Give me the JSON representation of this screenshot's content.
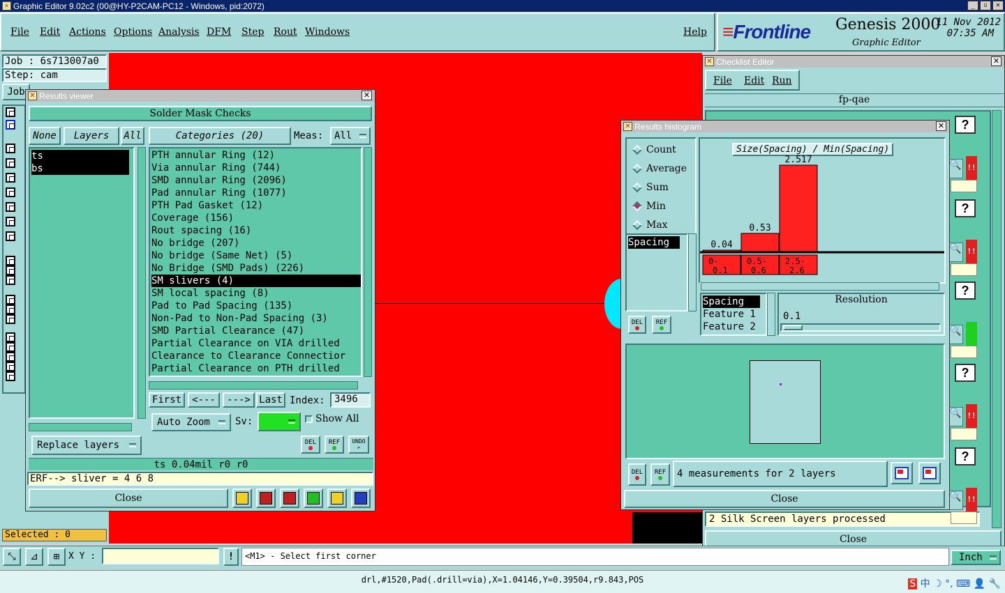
{
  "window": {
    "title": "Graphic Editor 9.02c2 (00@HY-P2CAM-PC12 - Windows, pid:2072)"
  },
  "menu": [
    "File",
    "Edit",
    "Actions",
    "Options",
    "Analysis",
    "DFM",
    "Step",
    "Rout",
    "Windows"
  ],
  "menu_help": "Help",
  "brand": {
    "name": "Frontline",
    "product": "Genesis 2000",
    "subtitle": "Graphic Editor",
    "date": "11 Nov 2012",
    "time": "07:35 AM"
  },
  "left_panel": {
    "job": "Job  : 6s713007a0",
    "step": "Step: cam",
    "job_btn": "Job",
    "selected": "Selected : 0"
  },
  "results_viewer": {
    "title": "Results viewer",
    "heading": "Solder Mask Checks",
    "none_btn": "None",
    "layers_btn": "Layers",
    "all_btn": "All",
    "layers": [
      "ts",
      "bs"
    ],
    "categories_btn": "Categories (20)",
    "meas_label": "Meas:",
    "meas_value": "All",
    "categories": [
      "PTH annular Ring (12)",
      "Via annular Ring (744)",
      "SMD annular Ring (2096)",
      "Pad annular Ring (1077)",
      "PTH Pad Gasket (12)",
      "Coverage (156)",
      "Rout spacing (16)",
      "No bridge (207)",
      "No bridge (Same Net) (5)",
      "No Bridge (SMD Pads) (226)",
      "SM slivers (4)",
      "SM local spacing (8)",
      "Pad to Pad Spacing (135)",
      "Non-Pad to Non-Pad Spacing (3)",
      "SMD Partial Clearance (47)",
      "Partial Clearance on VIA drilled",
      "Clearance to Clearance Connectior",
      "Partial Clearance on PTH drilled"
    ],
    "selected_category": 10,
    "first": "First",
    "prev": "<---",
    "next": "--->",
    "last": "Last",
    "index_label": "Index:",
    "index_value": "3496",
    "auto_zoom": "Auto Zoom",
    "sv_label": "Sv:",
    "show_all": "Show All",
    "replace_layers": "Replace layers",
    "del": "DEL",
    "ref": "REF",
    "undo": "UNDO",
    "status": "ts 0.04mil  r0  r0",
    "erf": "ERF--> sliver = 4 6 8",
    "close": "Close"
  },
  "histogram": {
    "title": "Results histogram",
    "options": [
      "Count",
      "Average",
      "Sum",
      "Min",
      "Max"
    ],
    "selected_option": 3,
    "list_item": "Spacing",
    "chart_title": "Size(Spacing) / Min(Spacing)",
    "del": "DEL",
    "ref": "REF",
    "feature_list": [
      "Spacing",
      "Feature 1",
      "Feature 2"
    ],
    "resolution_label": "Resolution",
    "resolution_value": "0.1",
    "measurements": "4 measurements for 2 layers",
    "close": "Close",
    "accent": "#ff2020"
  },
  "chart_data": {
    "type": "bar",
    "title": "Size(Spacing) / Min(Spacing)",
    "categories": [
      "0-\n0.1",
      "0.5-\n0.6",
      "2.5-\n2.6"
    ],
    "values": [
      0.04,
      0.53,
      2.517
    ],
    "value_labels": [
      "0.04",
      "0.53",
      "2.517"
    ]
  },
  "checklist": {
    "title": "Checklist Editor",
    "menu": [
      "File",
      "Edit",
      "Run"
    ],
    "name": "fp-qae",
    "status": "2 Silk Screen layers processed",
    "close": "Close"
  },
  "bottom": {
    "xy_label": "X Y :",
    "prompt": "<M1> - Select first corner",
    "units": "Inch",
    "info": "drl,#1520,Pad(.drill=via),X=1.04146,Y=0.39504,r9.843,POS"
  }
}
